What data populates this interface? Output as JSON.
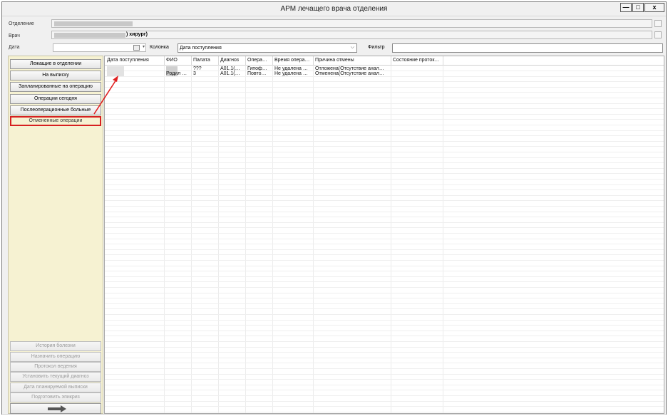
{
  "window": {
    "title": "АРМ лечащего врача отделения",
    "min_glyph": "—",
    "max_glyph": "□",
    "close_glyph": "x"
  },
  "form": {
    "department_label": "Отделение",
    "doctor_label": "Врач",
    "doctor_value_suffix": ") хирург)",
    "date_label": "Дата",
    "column_label": "Колонка",
    "column_value": "Дата поступления",
    "filter_label": "Фильтр",
    "filter_value": ""
  },
  "sidebar": {
    "nav": [
      {
        "label": "Лежащие в отделении",
        "state": "normal"
      },
      {
        "label": "На выписку",
        "state": "normal"
      },
      {
        "label": "Запланированные на операцию",
        "state": "normal"
      },
      {
        "label": "Операции сегодня",
        "state": "normal"
      },
      {
        "label": "Послеоперационные больные",
        "state": "normal"
      },
      {
        "label": "Отмененные операции",
        "state": "selected"
      }
    ],
    "actions": [
      {
        "label": "История болезни",
        "state": "disabled"
      },
      {
        "label": "Назначить операцию",
        "state": "disabled"
      },
      {
        "label": "Протокол ведения",
        "state": "disabled"
      },
      {
        "label": "Установить текущий диагноз",
        "state": "disabled"
      },
      {
        "label": "Дата планируемой выписки",
        "state": "disabled"
      },
      {
        "label": "Подготовить эпикриз",
        "state": "disabled"
      }
    ],
    "forward_icon": "arrow-right-icon"
  },
  "table": {
    "columns": [
      "Дата поступления",
      "ФИО",
      "Палата",
      "Диагноз",
      "Опера…",
      "Время опера…",
      "Причина отмены",
      "Состояние проток…"
    ],
    "rows": [
      {
        "fio": "",
        "palata": "???",
        "diagnoz": "A01.1(…",
        "operacia": "Гипоф…",
        "vremya": "Не удалена …",
        "prichina": "Отложена(Отсутствие анал…",
        "sostoyanie": ""
      },
      {
        "fio": "Родил …",
        "palata": "3",
        "diagnoz": "A01.1(…",
        "operacia": "Повто…",
        "vremya": "Не удалена …",
        "prichina": "Отменена(Отсутствие анал…",
        "sostoyanie": ""
      }
    ]
  },
  "colors": {
    "sidebar_bg": "#f6f2d2",
    "selected_border": "#d62020",
    "annotation_arrow": "#e02020"
  }
}
